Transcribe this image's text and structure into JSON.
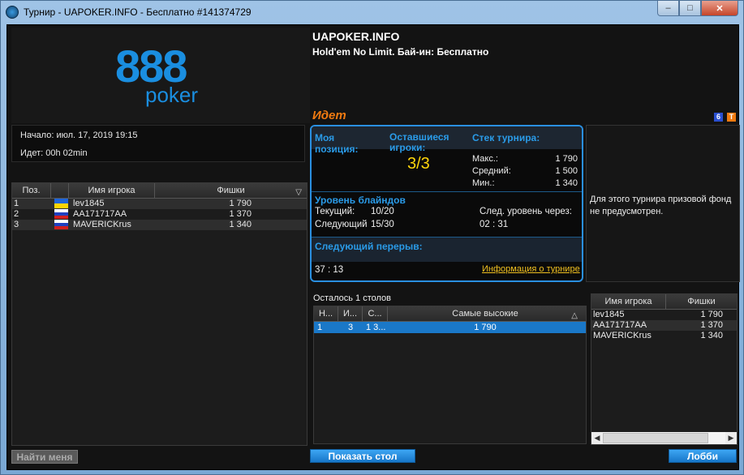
{
  "window": {
    "title": "Турнир - UAPOKER.INFO - Бесплатно #141374729",
    "minimize": "–",
    "maximize": "□",
    "close": "✕"
  },
  "logo": {
    "brand_top": "888",
    "brand_bottom": "poker"
  },
  "info": {
    "start": "Начало: июл. 17, 2019 19:15",
    "running": "Идет: 00h 02min"
  },
  "players": {
    "headers": {
      "pos": "Поз.",
      "name": "Имя игрока",
      "chips": "Фишки",
      "sort": "▽"
    },
    "rows": [
      {
        "pos": "1",
        "flag": "ukraine-flag",
        "name": "lev1845",
        "chips": "1 790"
      },
      {
        "pos": "2",
        "flag": "russia-flag",
        "name": "AA171717AA",
        "chips": "1 370"
      },
      {
        "pos": "3",
        "flag": "russia-flag",
        "name": "MAVERICKrus",
        "chips": "1 340"
      }
    ]
  },
  "tournament": {
    "name": "UAPOKER.INFO",
    "subtitle": "Hold'em No Limit. Бай-ин: Бесплатно",
    "status": "Идет",
    "badge1": "6",
    "badge2": "T",
    "badge1_color": "#2a4fd0",
    "badge2_color": "#f07a10"
  },
  "panel": {
    "my_position_label": "Моя позиция:",
    "players_left_label": "Оставшиеся игроки:",
    "players_left_value": "3/3",
    "stack_label": "Стек турнира:",
    "stack": [
      {
        "label": "Макс.:",
        "value": "1 790"
      },
      {
        "label": "Средний:",
        "value": "1 500"
      },
      {
        "label": "Мин.:",
        "value": "1 340"
      }
    ],
    "blinds_label": "Уровень блайндов",
    "current_label": "Текущий:",
    "current_value": "10/20",
    "next_label": "Следующий",
    "next_value": "15/30",
    "next_level_in_label": "След. уровень через:",
    "next_level_in_value": "02 : 31",
    "next_break_label": "Следующий перерыв:",
    "next_break_value": "37 : 13",
    "info_link": "Информация о турнире",
    "accent_color": "#2a9be8"
  },
  "prize": {
    "text": "Для этого турнира призовой фонд не предусмотрен."
  },
  "tables": {
    "label": "Осталось 1 столов",
    "headers": {
      "n": "Н...",
      "i": "И...",
      "s": "С...",
      "highest": "Самые высокие",
      "sort": "△"
    },
    "rows": [
      {
        "n": "1",
        "i": "3",
        "s": "1 3...",
        "highest": "1 790"
      }
    ]
  },
  "leaderboard": {
    "headers": {
      "name": "Имя игрока",
      "chips": "Фишки"
    },
    "rows": [
      {
        "name": "lev1845",
        "chips": "1 790"
      },
      {
        "name": "AA171717AA",
        "chips": "1 370"
      },
      {
        "name": "MAVERICKrus",
        "chips": "1 340"
      }
    ],
    "scroll_left": "◀",
    "scroll_right": "▶"
  },
  "buttons": {
    "find_me": "Найти меня",
    "show_table": "Показать стол",
    "lobby": "Лобби"
  }
}
